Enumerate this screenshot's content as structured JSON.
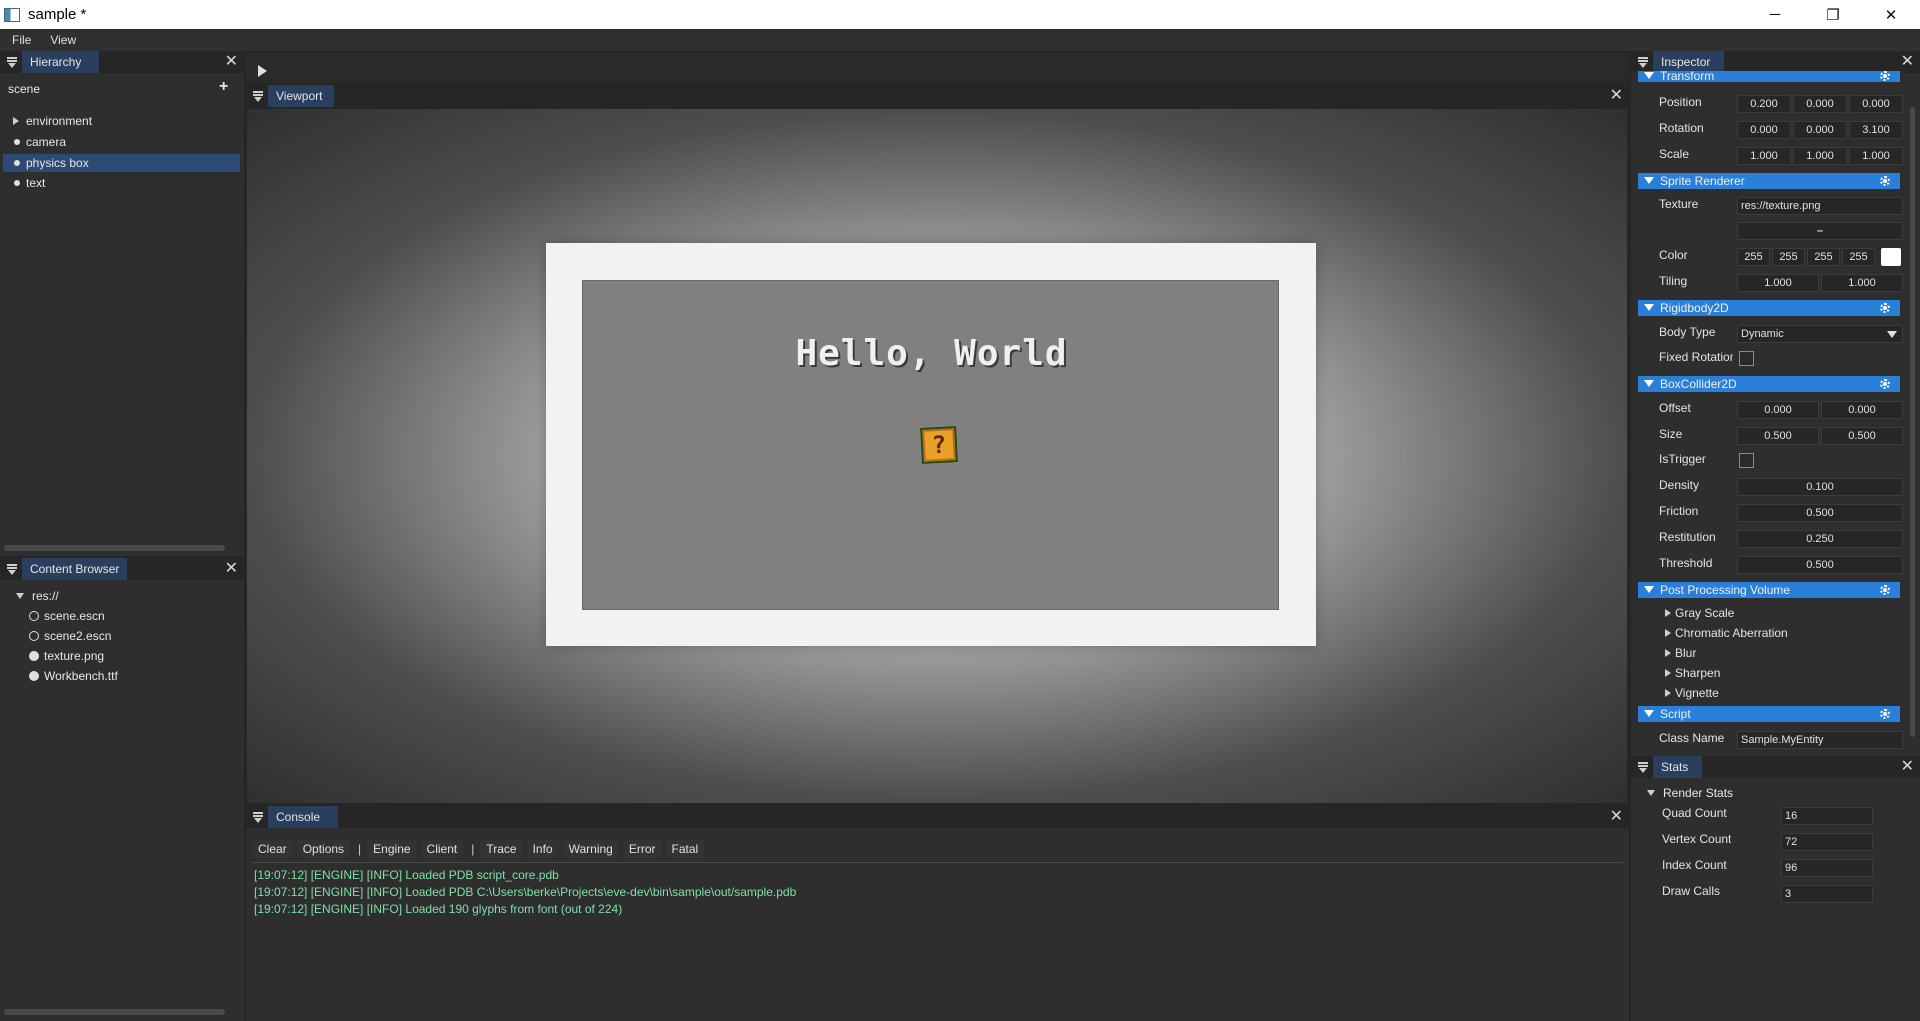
{
  "window": {
    "title": "sample *",
    "minimize": "─",
    "restore": "❐",
    "close": "✕"
  },
  "menu": [
    "File",
    "View"
  ],
  "hierarchy": {
    "title": "Hierarchy",
    "root": "scene",
    "add": "+",
    "items": [
      "environment",
      "camera",
      "physics box",
      "text"
    ]
  },
  "content_browser": {
    "title": "Content Browser",
    "root": "res://",
    "items": [
      "scene.escn",
      "scene2.escn",
      "texture.png",
      "Workbench.ttf"
    ]
  },
  "viewport": {
    "title": "Viewport",
    "hello_text": "Hello, World",
    "block_glyph": "?"
  },
  "console": {
    "title": "Console",
    "buttons": [
      "Clear",
      "Options"
    ],
    "filters_a": [
      "Engine",
      "Client"
    ],
    "filters_b": [
      "Trace",
      "Info",
      "Warning",
      "Error",
      "Fatal"
    ],
    "separator": "|",
    "lines": [
      "[19:07:12] [ENGINE] [INFO] Loaded PDB script_core.pdb",
      "[19:07:12] [ENGINE] [INFO] Loaded PDB C:\\Users\\berke\\Projects\\eve-dev\\bin\\sample\\out/sample.pdb",
      "[19:07:12] [ENGINE] [INFO] Loaded 190 glyphs from font (out of 224)"
    ]
  },
  "inspector": {
    "title": "Inspector",
    "transform": {
      "title": "Transform",
      "position_label": "Position",
      "position": [
        "0.200",
        "0.000",
        "0.000"
      ],
      "rotation_label": "Rotation",
      "rotation": [
        "0.000",
        "0.000",
        "3.100"
      ],
      "scale_label": "Scale",
      "scale": [
        "1.000",
        "1.000",
        "1.000"
      ]
    },
    "sprite": {
      "title": "Sprite Renderer",
      "texture_label": "Texture",
      "texture": "res://texture.png",
      "texture_sub": "–",
      "color_label": "Color",
      "color": [
        "255",
        "255",
        "255",
        "255"
      ],
      "swatch": "#ffffff",
      "tiling_label": "Tiling",
      "tiling": [
        "1.000",
        "1.000"
      ]
    },
    "rigidbody": {
      "title": "Rigidbody2D",
      "body_type_label": "Body Type",
      "body_type": "Dynamic",
      "fixed_rot_label": "Fixed Rotation"
    },
    "collider": {
      "title": "BoxCollider2D",
      "offset_label": "Offset",
      "offset": [
        "0.000",
        "0.000"
      ],
      "size_label": "Size",
      "size": [
        "0.500",
        "0.500"
      ],
      "trigger_label": "IsTrigger",
      "density_label": "Density",
      "density": "0.100",
      "friction_label": "Friction",
      "friction": "0.500",
      "restitution_label": "Restitution",
      "restitution": "0.250",
      "threshold_label": "Threshold",
      "threshold": "0.500"
    },
    "post": {
      "title": "Post Processing Volume",
      "items": [
        "Gray Scale",
        "Chromatic Aberration",
        "Blur",
        "Sharpen",
        "Vignette"
      ]
    },
    "script": {
      "title": "Script",
      "class_label": "Class Name",
      "class_name": "Sample.MyEntity"
    }
  },
  "stats": {
    "title": "Stats",
    "group": "Render Stats",
    "quad_label": "Quad Count",
    "quad": "16",
    "vertex_label": "Vertex Count",
    "vertex": "72",
    "index_label": "Index Count",
    "index": "96",
    "draw_label": "Draw Calls",
    "draw": "3"
  },
  "colors": {
    "accent": "#2a7fd8",
    "tab": "#2a3f5e",
    "log": "#7fe0a8",
    "selection": "#2c4a73"
  }
}
